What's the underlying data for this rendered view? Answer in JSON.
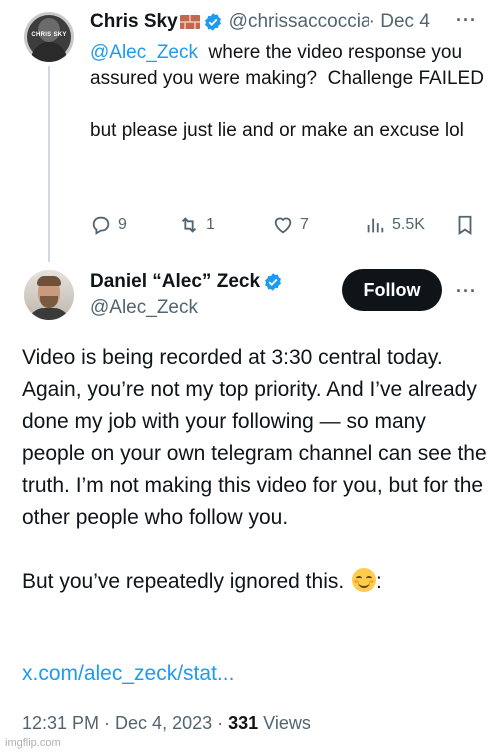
{
  "reply_tweet": {
    "author_name": "Chris Sky",
    "avatar_label": "CHRIS SKY",
    "handle": "@chrissaccoccia",
    "date": "· Dec 4",
    "mention": "@Alec_Zeck",
    "text_after_mention": "  where the video response you assured you were making?  Challenge FAILED\n\nbut please just lie and or make an excuse lol",
    "stats": {
      "replies": "9",
      "reposts": "1",
      "likes": "7",
      "views": "5.5K"
    },
    "icons": [
      "reply-icon",
      "repost-icon",
      "like-icon",
      "views-icon",
      "bookmark-icon",
      "more-icon",
      "verified-icon",
      "brick-emoji-icon"
    ]
  },
  "main_tweet": {
    "author_name": "Daniel “Alec” Zeck",
    "handle": "@Alec_Zeck",
    "follow_label": "Follow",
    "text_main": "Video is being recorded at 3:30 central today. Again, you’re not my top priority. And I’ve already done my job with your following — so many people on your own telegram channel can see the truth. I’m not making this video for you, but for the other people who follow you.\n\nBut you’ve repeatedly ignored this. ",
    "text_after_emoji": ":",
    "link": "x.com/alec_zeck/stat...",
    "timestamp": "12:31 PM · Dec 4, 2023 · ",
    "views_count": "331",
    "views_label": " Views"
  },
  "watermark": "imgflip.com",
  "colors": {
    "accent": "#1d9bf0",
    "text": "#0f1419",
    "muted": "#536471",
    "button": "#0f1419"
  }
}
